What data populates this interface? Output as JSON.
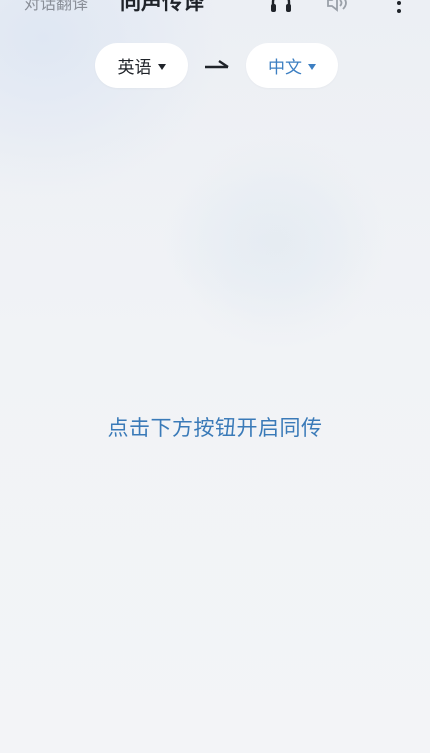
{
  "header": {
    "tab_dialog": "对话翻译",
    "tab_simultaneous": "同声传译",
    "icons": [
      "headset-icon",
      "speaker-icon",
      "more-icon"
    ]
  },
  "languages": {
    "source": "英语",
    "target": "中文",
    "swap_icon": "arrow-right-icon"
  },
  "main": {
    "hint": "点击下方按钮开启同传"
  },
  "colors": {
    "accent": "#3d7fc2",
    "text_primary": "#1f2329",
    "text_secondary": "#8a8f98",
    "background": "#f2f4f7"
  }
}
